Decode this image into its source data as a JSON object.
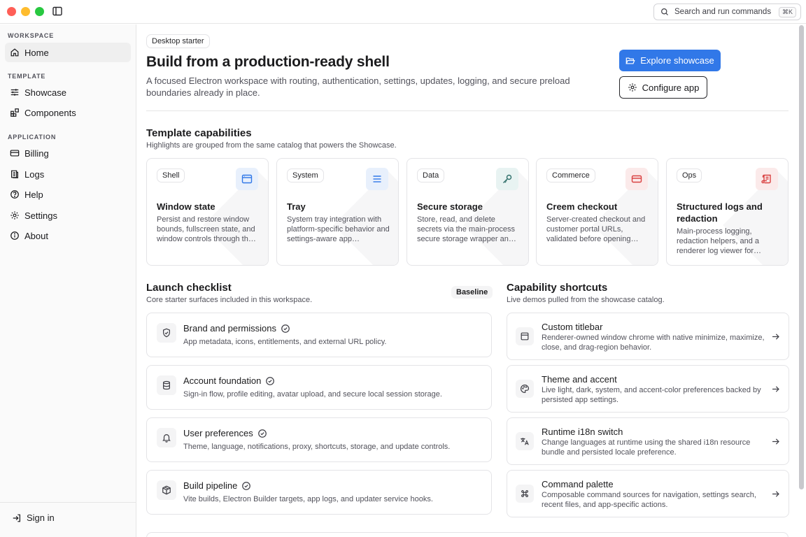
{
  "titlebar": {
    "search_placeholder": "Search and run commands",
    "shortcut": "⌘K"
  },
  "sidebar": {
    "sections": {
      "workspace": "WORKSPACE",
      "template": "TEMPLATE",
      "application": "APPLICATION"
    },
    "items": [
      {
        "label": "Home",
        "icon": "home-icon",
        "active": true
      },
      {
        "label": "Showcase",
        "icon": "sliders-icon"
      },
      {
        "label": "Components",
        "icon": "blocks-icon"
      },
      {
        "label": "Billing",
        "icon": "credit-card-icon"
      },
      {
        "label": "Logs",
        "icon": "logs-icon"
      },
      {
        "label": "Help",
        "icon": "help-circle-icon"
      },
      {
        "label": "Settings",
        "icon": "gear-icon"
      },
      {
        "label": "About",
        "icon": "info-icon"
      }
    ],
    "footer": {
      "sign_in": "Sign in"
    }
  },
  "hero": {
    "chip": "Desktop starter",
    "title": "Build from a production-ready shell",
    "description": "A focused Electron workspace with routing, authentication, settings, updates, logging, and secure preload boundaries already in place.",
    "primary_button": "Explore showcase",
    "secondary_button": "Configure app"
  },
  "capabilities": {
    "title": "Template capabilities",
    "subtitle": "Highlights are grouped from the same catalog that powers the Showcase.",
    "cards": [
      {
        "tag": "Shell",
        "title": "Window state",
        "description": "Persist and restore window bounds, fullscreen state, and window controls through th…",
        "icon": "app-window-icon",
        "accent": "#3178e8",
        "accent_bg": "#e8f0fc"
      },
      {
        "tag": "System",
        "title": "Tray",
        "description": "System tray integration with platform-specific behavior and settings-aware app…",
        "icon": "menu-lines-icon",
        "accent": "#3178e8",
        "accent_bg": "#e8f0fc"
      },
      {
        "tag": "Data",
        "title": "Secure storage",
        "description": "Store, read, and delete secrets via the main-process secure storage wrapper an…",
        "icon": "key-icon",
        "accent": "#2f6f6a",
        "accent_bg": "#e8f3f2"
      },
      {
        "tag": "Commerce",
        "title": "Creem checkout",
        "description": "Server-created checkout and customer portal URLs, validated before opening…",
        "icon": "credit-card-icon",
        "accent": "#d94141",
        "accent_bg": "#fbeaea"
      },
      {
        "tag": "Ops",
        "title": "Structured logs and redaction",
        "description": "Main-process logging, redaction helpers, and a renderer log viewer for…",
        "icon": "scroll-icon",
        "accent": "#d94141",
        "accent_bg": "#fbeaea"
      }
    ]
  },
  "checklist": {
    "title": "Launch checklist",
    "subtitle": "Core starter surfaces included in this workspace.",
    "badge": "Baseline",
    "items": [
      {
        "title": "Brand and permissions",
        "description": "App metadata, icons, entitlements, and external URL policy.",
        "icon": "shield-icon"
      },
      {
        "title": "Account foundation",
        "description": "Sign-in flow, profile editing, avatar upload, and secure local session storage.",
        "icon": "database-icon"
      },
      {
        "title": "User preferences",
        "description": "Theme, language, notifications, proxy, shortcuts, storage, and update controls.",
        "icon": "bell-icon"
      },
      {
        "title": "Build pipeline",
        "description": "Vite builds, Electron Builder targets, app logs, and updater service hooks.",
        "icon": "package-icon"
      }
    ]
  },
  "shortcuts": {
    "title": "Capability shortcuts",
    "subtitle": "Live demos pulled from the showcase catalog.",
    "items": [
      {
        "title": "Custom titlebar",
        "description": "Renderer-owned window chrome with native minimize, maximize, close, and drag-region behavior.",
        "icon": "panel-top-icon"
      },
      {
        "title": "Theme and accent",
        "description": "Live light, dark, system, and accent-color preferences backed by persisted app settings.",
        "icon": "palette-icon"
      },
      {
        "title": "Runtime i18n switch",
        "description": "Change languages at runtime using the shared i18n resource bundle and persisted locale preference.",
        "icon": "languages-icon"
      },
      {
        "title": "Command palette",
        "description": "Composable command sources for navigation, settings search, recent files, and app-specific actions.",
        "icon": "command-icon"
      }
    ]
  },
  "colors": {
    "accent": "#3178e8",
    "border": "#e4e4e7",
    "muted_text": "#52525b"
  }
}
